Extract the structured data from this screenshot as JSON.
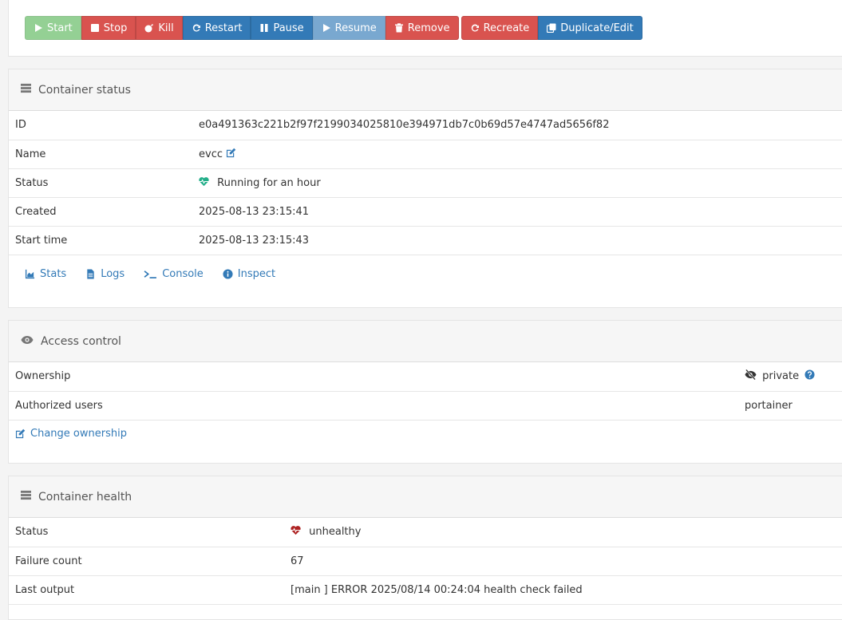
{
  "actions": {
    "start": "Start",
    "stop": "Stop",
    "kill": "Kill",
    "restart": "Restart",
    "pause": "Pause",
    "resume": "Resume",
    "remove": "Remove",
    "recreate": "Recreate",
    "duplicate_edit": "Duplicate/Edit"
  },
  "status_panel": {
    "title": "Container status",
    "rows": [
      {
        "label": "ID",
        "value": "e0a491363c221b2f97f2199034025810e394971db7c0b69d57e4747ad5656f82"
      },
      {
        "label": "Name",
        "value": "evcc"
      },
      {
        "label": "Status",
        "value": "Running for an hour"
      },
      {
        "label": "Created",
        "value": "2025-08-13 23:15:41"
      },
      {
        "label": "Start time",
        "value": "2025-08-13 23:15:43"
      }
    ],
    "links": {
      "stats": "Stats",
      "logs": "Logs",
      "console": "Console",
      "inspect": "Inspect"
    }
  },
  "access_panel": {
    "title": "Access control",
    "rows": [
      {
        "label": "Ownership",
        "value": "private"
      },
      {
        "label": "Authorized users",
        "value": "portainer"
      }
    ],
    "change_ownership": "Change ownership"
  },
  "health_panel": {
    "title": "Container health",
    "rows": [
      {
        "label": "Status",
        "value": "unhealthy"
      },
      {
        "label": "Failure count",
        "value": "67"
      },
      {
        "label": "Last output",
        "value": "[main ] ERROR 2025/08/14 00:24:04 health check failed"
      }
    ]
  },
  "colors": {
    "success": "#5cb85c",
    "danger": "#d9534f",
    "primary": "#337ab7",
    "healthy": "#23ae89",
    "unhealthy": "#ae2323"
  }
}
